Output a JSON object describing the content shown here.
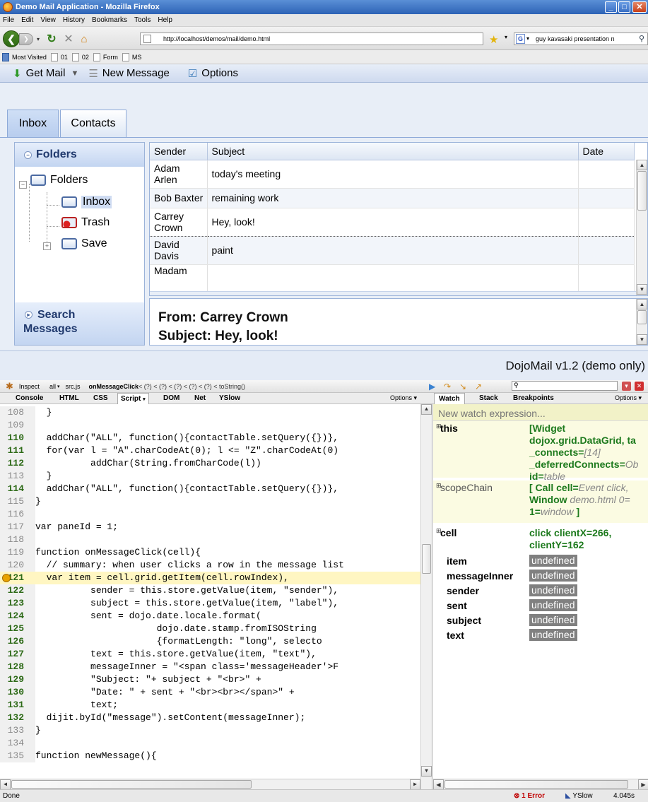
{
  "window": {
    "title": "Demo Mail Application - Mozilla Firefox"
  },
  "menu": [
    "File",
    "Edit",
    "View",
    "History",
    "Bookmarks",
    "Tools",
    "Help"
  ],
  "nav": {
    "url": "http://localhost/demos/mail/demo.html",
    "search": "guy kavasaki presentation n"
  },
  "bookmarks": [
    "Most Visited",
    "01",
    "02",
    "Form",
    "MS"
  ],
  "toolbar": {
    "get_mail": "Get Mail",
    "new_message": "New Message",
    "options": "Options"
  },
  "tabs": {
    "inbox": "Inbox",
    "contacts": "Contacts"
  },
  "folders": {
    "title": "Folders",
    "root": "Folders",
    "items": [
      "Inbox",
      "Trash",
      "Save"
    ],
    "search_title_1": "Search",
    "search_title_2": "Messages"
  },
  "grid": {
    "columns": {
      "sender": "Sender",
      "subject": "Subject",
      "date": "Date"
    },
    "rows": [
      {
        "sender1": "Adam",
        "sender2": "Arlen",
        "subject": "today's meeting"
      },
      {
        "sender1": "Bob Baxter",
        "sender2": "",
        "subject": "remaining work"
      },
      {
        "sender1": "Carrey",
        "sender2": "Crown",
        "subject": "Hey, look!"
      },
      {
        "sender1": "David",
        "sender2": "Davis",
        "subject": "paint"
      },
      {
        "sender1": "Madam",
        "sender2": "",
        "subject": ""
      }
    ]
  },
  "message": {
    "from": "From: Carrey Crown",
    "subject": "Subject: Hey, look!"
  },
  "footer": "DojoMail v1.2 (demo only)",
  "firebug": {
    "inspect": "Inspect",
    "all": "all",
    "file": "src.js",
    "stack_fn": "onMessageClick",
    "stack_rest": " < (?) < (?) < (?) < (?) < (?) < toString()",
    "tabs": [
      "Console",
      "HTML",
      "CSS",
      "Script",
      "DOM",
      "Net",
      "YSlow"
    ],
    "options": "Options",
    "side_tabs": [
      "Watch",
      "Stack",
      "Breakpoints"
    ],
    "side_options": "Options"
  },
  "code": [
    {
      "n": "108",
      "t": "  }",
      "dim": true
    },
    {
      "n": "109",
      "t": "",
      "dim": true
    },
    {
      "n": "110",
      "t": "  addChar(\"ALL\", function(){contactTable.setQuery({})},",
      "dim": false
    },
    {
      "n": "111",
      "t": "  for(var l = \"A\".charCodeAt(0); l <= \"Z\".charCodeAt(0)",
      "dim": false
    },
    {
      "n": "112",
      "t": "          addChar(String.fromCharCode(l))",
      "dim": false
    },
    {
      "n": "113",
      "t": "  }",
      "dim": true
    },
    {
      "n": "114",
      "t": "  addChar(\"ALL\", function(){contactTable.setQuery({})},",
      "dim": false
    },
    {
      "n": "115",
      "t": "}",
      "dim": true
    },
    {
      "n": "116",
      "t": "",
      "dim": true
    },
    {
      "n": "117",
      "t": "var paneId = 1;",
      "dim": true
    },
    {
      "n": "118",
      "t": "",
      "dim": true
    },
    {
      "n": "119",
      "t": "function onMessageClick(cell){",
      "dim": true
    },
    {
      "n": "120",
      "t": "  // summary: when user clicks a row in the message list",
      "dim": true
    },
    {
      "n": "121",
      "t": "  var item = cell.grid.getItem(cell.rowIndex),",
      "dim": false,
      "hl": true
    },
    {
      "n": "122",
      "t": "          sender = this.store.getValue(item, \"sender\"),",
      "dim": false
    },
    {
      "n": "123",
      "t": "          subject = this.store.getValue(item, \"label\"),",
      "dim": false
    },
    {
      "n": "124",
      "t": "          sent = dojo.date.locale.format(",
      "dim": false
    },
    {
      "n": "125",
      "t": "                      dojo.date.stamp.fromISOString",
      "dim": false
    },
    {
      "n": "126",
      "t": "                      {formatLength: \"long\", selecto",
      "dim": false
    },
    {
      "n": "127",
      "t": "          text = this.store.getValue(item, \"text\"),",
      "dim": false
    },
    {
      "n": "128",
      "t": "          messageInner = \"<span class='messageHeader'>F",
      "dim": false
    },
    {
      "n": "129",
      "t": "          \"Subject: \"+ subject + \"<br>\" +",
      "dim": false
    },
    {
      "n": "130",
      "t": "          \"Date: \" + sent + \"<br><br></span>\" +",
      "dim": false
    },
    {
      "n": "131",
      "t": "          text;",
      "dim": false
    },
    {
      "n": "132",
      "t": "  dijit.byId(\"message\").setContent(messageInner);",
      "dim": false
    },
    {
      "n": "133",
      "t": "}",
      "dim": true
    },
    {
      "n": "134",
      "t": "",
      "dim": true
    },
    {
      "n": "135",
      "t": "function newMessage(){",
      "dim": true
    }
  ],
  "watch": {
    "new_expression": "New watch expression...",
    "this_key": "this",
    "this_l1": "[Widget",
    "this_l2": "dojox.grid.DataGrid, ta",
    "this_l3a": "_connects=",
    "this_l3b": "[14]",
    "this_l4a": "_deferredConnects=",
    "this_l4b": "Ob",
    "this_l5a": "id=",
    "this_l5b": "table",
    "scope_key": "scopeChain",
    "scope_l1a": "[ Call cell=",
    "scope_l1b": "Event click,",
    "scope_l2a": "Window ",
    "scope_l2b": "demo.html 0=",
    "scope_l3a": "1=",
    "scope_l3b": "window",
    "scope_l3c": " ]",
    "cell_key": "cell",
    "cell_l1": "click clientX=266,",
    "cell_l2": "clientY=162",
    "vars": [
      {
        "k": "item",
        "v": "undefined"
      },
      {
        "k": "messageInner",
        "v": "undefined"
      },
      {
        "k": "sender",
        "v": "undefined"
      },
      {
        "k": "sent",
        "v": "undefined"
      },
      {
        "k": "subject",
        "v": "undefined"
      },
      {
        "k": "text",
        "v": "undefined"
      }
    ]
  },
  "status": {
    "left": "Done",
    "error": "1 Error",
    "yslow": "YSlow",
    "time": "4.045s"
  },
  "icons": {
    "get_mail": "down-arrow-icon",
    "new_message": "document-icon",
    "options": "checklist-icon"
  }
}
